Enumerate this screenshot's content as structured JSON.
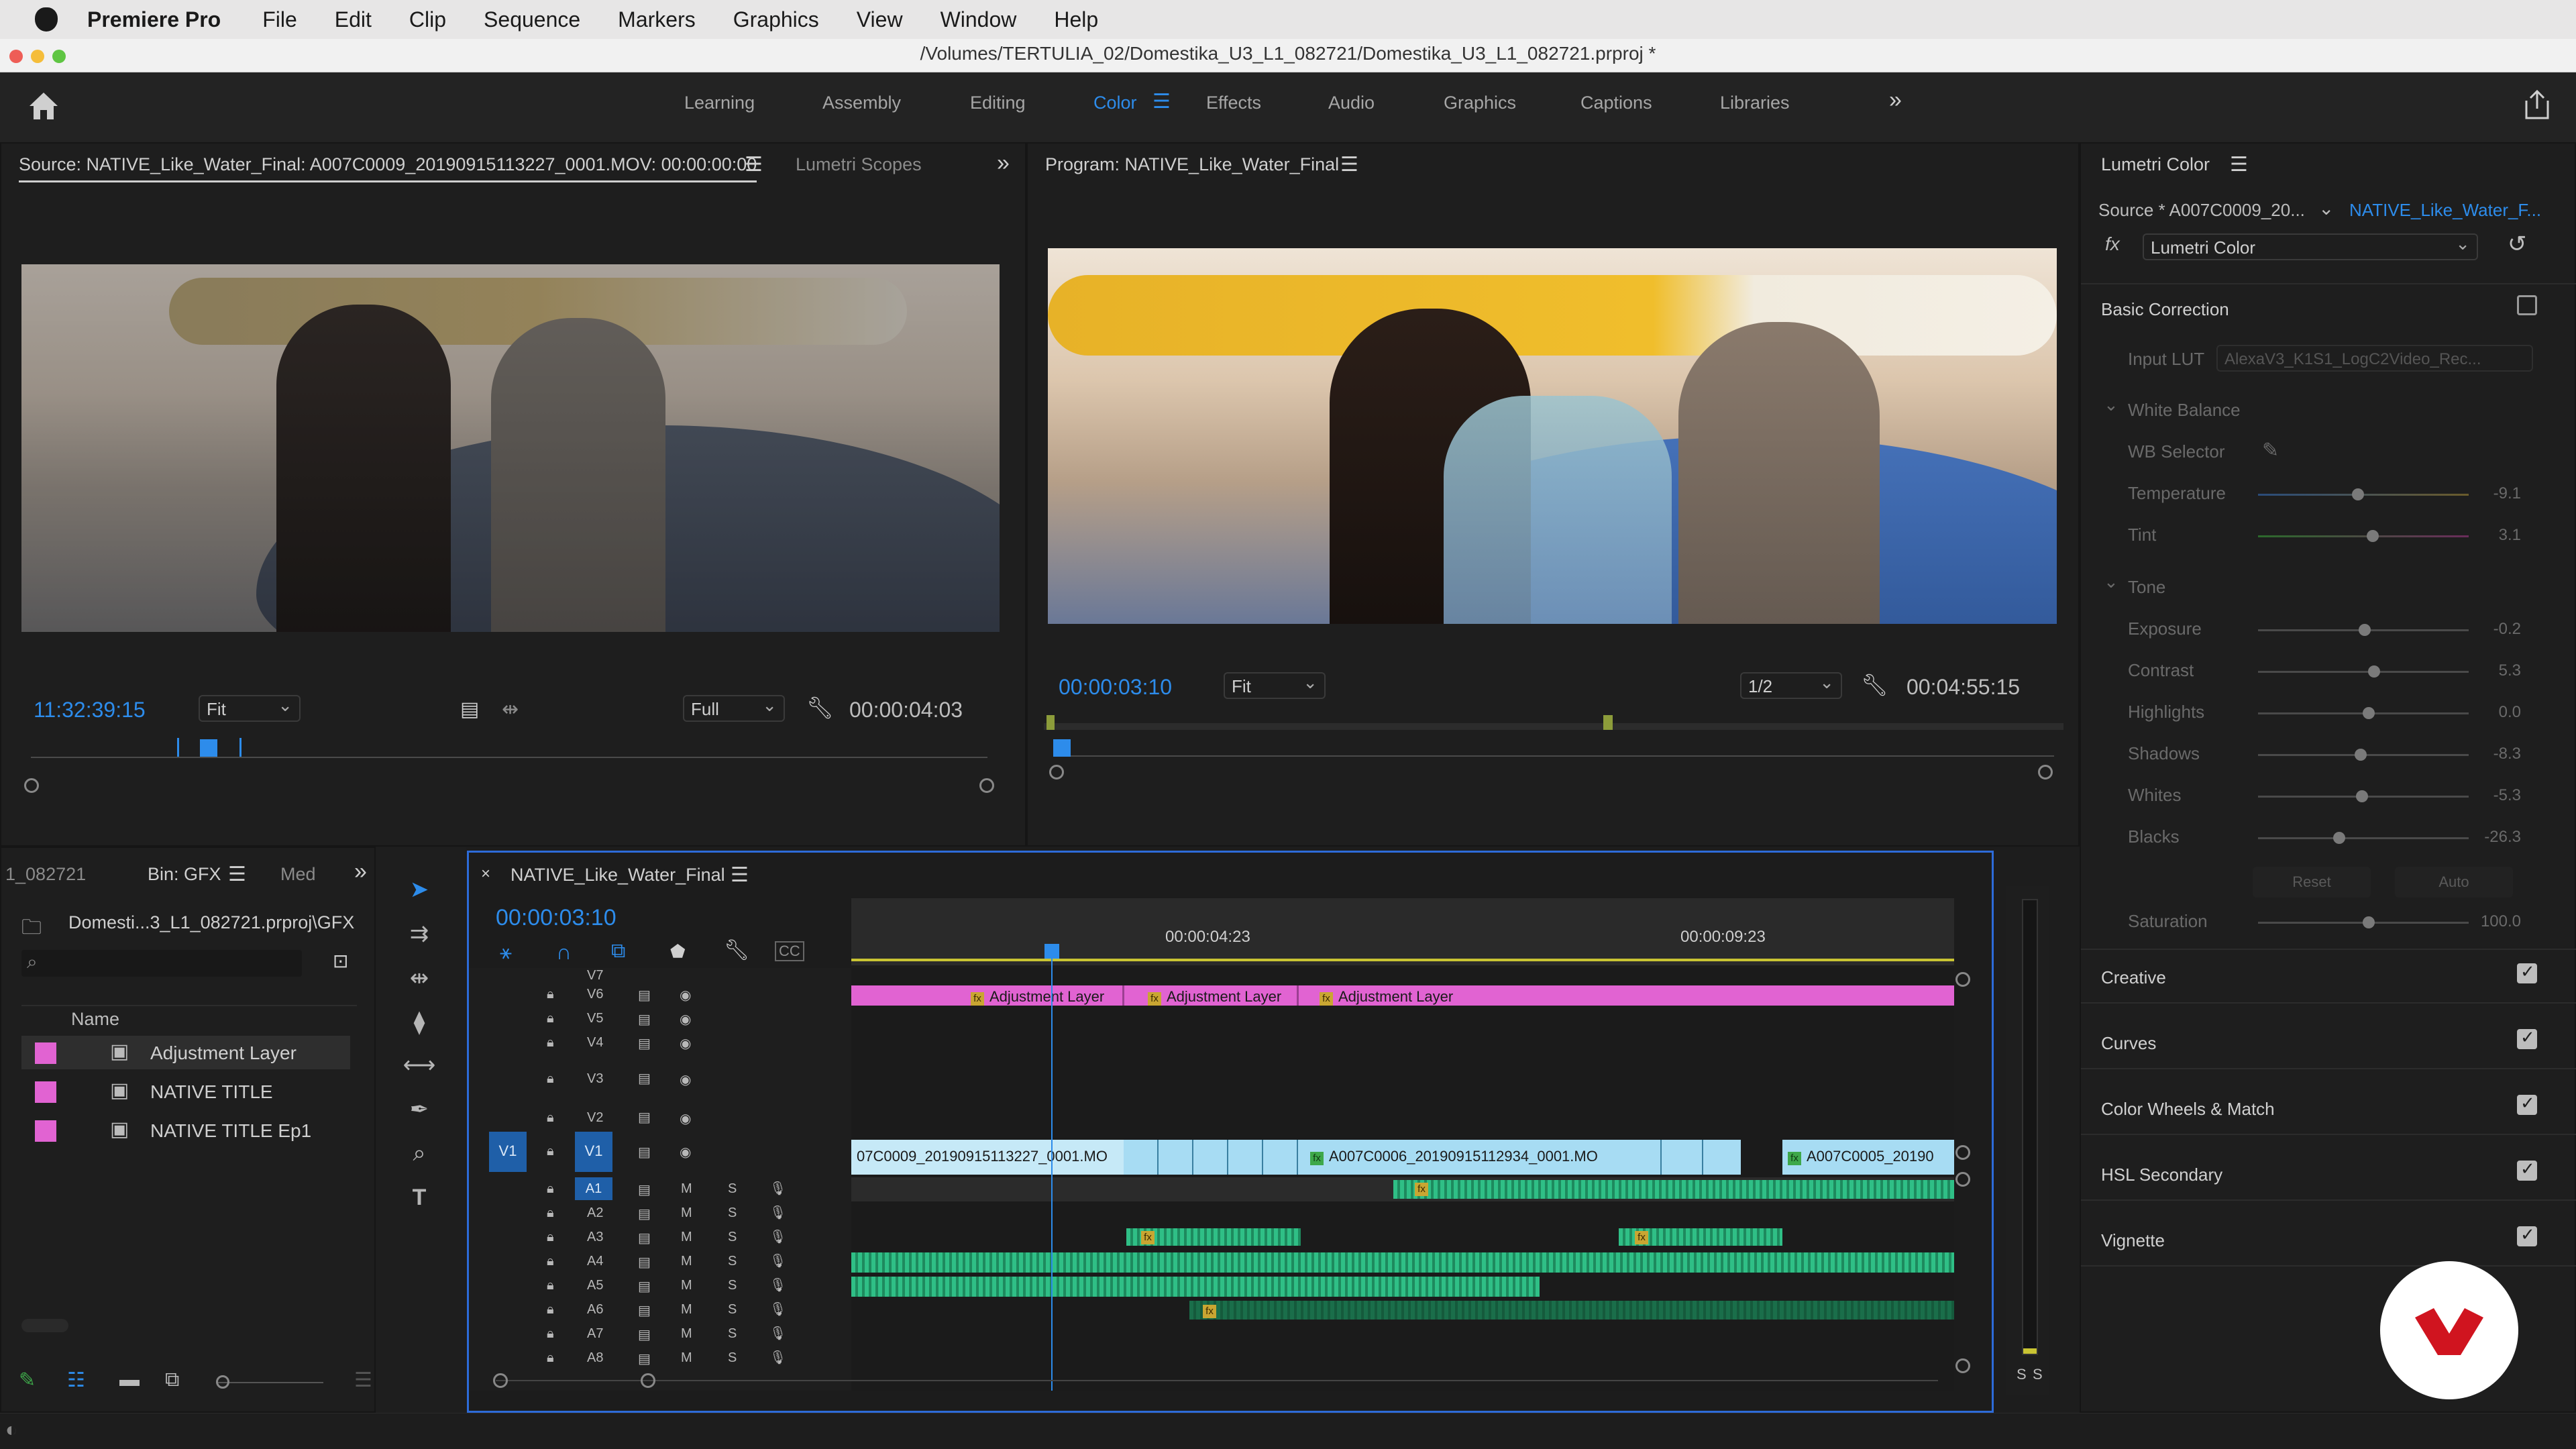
{
  "menubar": {
    "app_name": "Premiere Pro",
    "items": [
      "File",
      "Edit",
      "Clip",
      "Sequence",
      "Markers",
      "Graphics",
      "View",
      "Window",
      "Help"
    ]
  },
  "window": {
    "title": "/Volumes/TERTULIA_02/Domestika_U3_L1_082721/Domestika_U3_L1_082721.prproj *"
  },
  "workspaces": {
    "tabs": [
      "Learning",
      "Assembly",
      "Editing",
      "Color",
      "Effects",
      "Audio",
      "Graphics",
      "Captions",
      "Libraries"
    ],
    "active": "Color",
    "overflow_icon": "double-chevron-right-icon"
  },
  "source_monitor": {
    "tab_label": "Source: NATIVE_Like_Water_Final: A007C0009_20190915113227_0001.MOV: 00:00:00:00",
    "secondary_tab": "Lumetri Scopes",
    "timecode": "11:32:39:15",
    "fit": "Fit",
    "quality": "Full",
    "duration": "00:00:04:03"
  },
  "program_monitor": {
    "tab_label": "Program: NATIVE_Like_Water_Final",
    "timecode": "00:00:03:10",
    "fit": "Fit",
    "resolution": "1/2",
    "duration": "00:04:55:15"
  },
  "project_panel": {
    "tabs": [
      "1_082721",
      "Bin: GFX",
      "Med"
    ],
    "path": "Domesti...3_L1_082721.prproj\\GFX",
    "column_name": "Name",
    "items": [
      {
        "name": "Adjustment Layer",
        "color": "#e163d2"
      },
      {
        "name": "NATIVE TITLE",
        "color": "#e163d2"
      },
      {
        "name": "NATIVE TITLE Ep1",
        "color": "#e163d2"
      }
    ]
  },
  "timeline": {
    "tab_label": "NATIVE_Like_Water_Final",
    "timecode": "00:00:03:10",
    "ruler_labels": [
      "00:00:04:23",
      "00:00:09:23"
    ],
    "video_tracks": [
      "V7",
      "V6",
      "V5",
      "V4",
      "V3",
      "V2",
      "V1"
    ],
    "audio_tracks": [
      "A1",
      "A2",
      "A3",
      "A4",
      "A5",
      "A6",
      "A7",
      "A8"
    ],
    "source_patch": "V1",
    "adjustment_clips": [
      "Adjustment Layer",
      "Adjustment Layer",
      "Adjustment Layer"
    ],
    "v1_clips": [
      "07C0009_20190915113227_0001.MO",
      "A007C0006_20190915112934_0001.MO",
      "A007C0005_20190"
    ],
    "mute_label": "M",
    "solo_label": "S",
    "meter_labels": [
      "S",
      "S"
    ]
  },
  "lumetri": {
    "tab_label": "Lumetri Color",
    "source_label": "Source * A007C0009_20...",
    "sequence_label": "NATIVE_Like_Water_F...",
    "fx_label": "fx",
    "effect_name": "Lumetri Color",
    "basic_correction": "Basic Correction",
    "input_lut_label": "Input LUT",
    "input_lut_value": "AlexaV3_K1S1_LogC2Video_Rec...",
    "white_balance": "White Balance",
    "wb_selector": "WB Selector",
    "temperature": {
      "label": "Temperature",
      "value": "-9.1"
    },
    "tint": {
      "label": "Tint",
      "value": "3.1"
    },
    "tone": "Tone",
    "tone_sliders": [
      {
        "label": "Exposure",
        "value": "-0.2"
      },
      {
        "label": "Contrast",
        "value": "5.3"
      },
      {
        "label": "Highlights",
        "value": "0.0"
      },
      {
        "label": "Shadows",
        "value": "-8.3"
      },
      {
        "label": "Whites",
        "value": "-5.3"
      },
      {
        "label": "Blacks",
        "value": "-26.3"
      }
    ],
    "reset_label": "Reset",
    "auto_label": "Auto",
    "saturation": {
      "label": "Saturation",
      "value": "100.0"
    },
    "sections": [
      "Creative",
      "Curves",
      "Color Wheels & Match",
      "HSL Secondary",
      "Vignette"
    ]
  },
  "colors": {
    "accent_blue": "#2d8ceb",
    "adjustment_pink": "#e163d2",
    "video_clip": "#a7dcf3",
    "audio_clip": "#2fbf86",
    "brand_red": "#d0141f"
  }
}
